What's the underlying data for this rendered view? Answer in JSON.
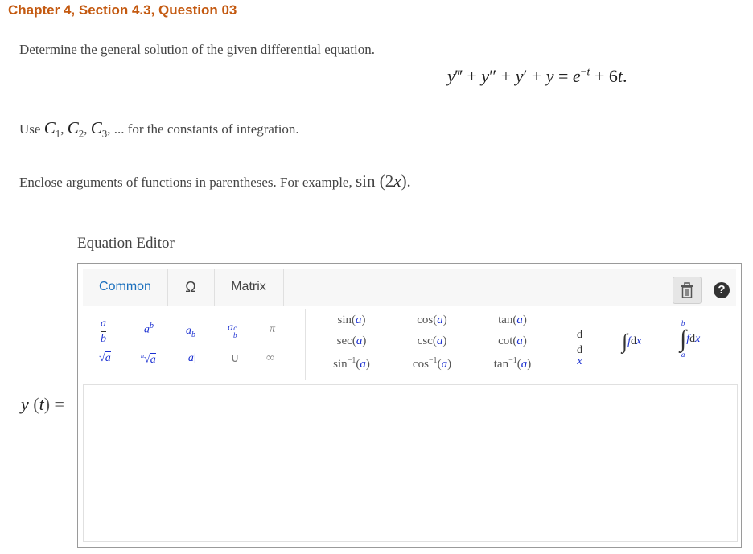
{
  "header": {
    "title": "Chapter 4, Section 4.3, Question 03"
  },
  "question": {
    "prompt": "Determine the general solution of the given differential equation.",
    "use_prefix": "Use",
    "use_suffix": "for the constants of integration.",
    "enclose_text": "Enclose arguments of functions in parentheses. For example,",
    "example": "sin (2x)."
  },
  "editor": {
    "label": "Equation Editor",
    "tabs": [
      "Common",
      "Ω",
      "Matrix"
    ],
    "active_tab": "Common",
    "toolbar": {
      "trash_icon": "trash-icon",
      "help_icon": "help-icon",
      "help_glyph": "?"
    },
    "functions": {
      "row1": [
        "sin(a)",
        "cos(a)",
        "tan(a)"
      ],
      "row2": [
        "sec(a)",
        "csc(a)",
        "cot(a)"
      ],
      "row3": [
        "sin⁻¹(a)",
        "cos⁻¹(a)",
        "tan⁻¹(a)"
      ]
    },
    "answer_label": "y (t) ="
  },
  "colors": {
    "title": "#c45a11",
    "accent": "#1a6fbd",
    "symbol": "#1a2fd1"
  }
}
